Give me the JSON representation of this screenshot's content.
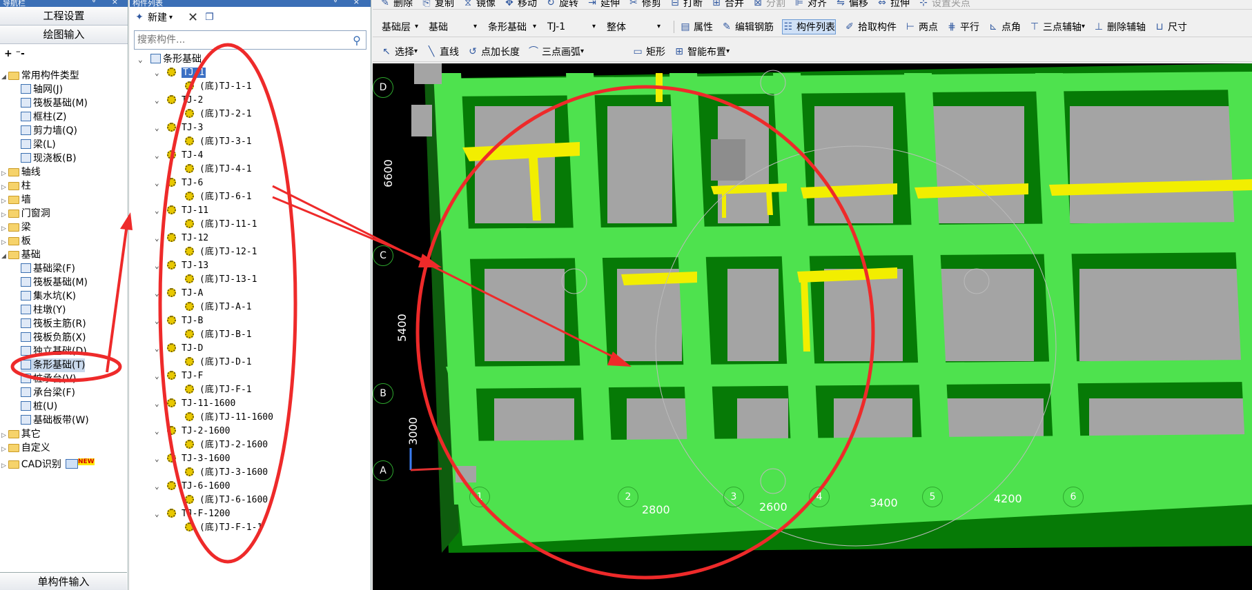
{
  "nav": {
    "title": "导航栏",
    "btn_project": "工程设置",
    "btn_draw": "绘图输入",
    "tree_tools": "+ ⁻-",
    "items": [
      {
        "label": "常用构件类型"
      },
      {
        "label": "轴网(J)"
      },
      {
        "label": "筏板基础(M)"
      },
      {
        "label": "框柱(Z)"
      },
      {
        "label": "剪力墙(Q)"
      },
      {
        "label": "梁(L)"
      },
      {
        "label": "现浇板(B)"
      },
      {
        "label": "轴线"
      },
      {
        "label": "柱"
      },
      {
        "label": "墙"
      },
      {
        "label": "门窗洞"
      },
      {
        "label": "梁"
      },
      {
        "label": "板"
      },
      {
        "label": "基础"
      },
      {
        "label": "基础梁(F)"
      },
      {
        "label": "筏板基础(M)"
      },
      {
        "label": "集水坑(K)"
      },
      {
        "label": "柱墩(Y)"
      },
      {
        "label": "筏板主筋(R)"
      },
      {
        "label": "筏板负筋(X)"
      },
      {
        "label": "独立基础(D)"
      },
      {
        "label": "条形基础(T)"
      },
      {
        "label": "桩承台(V)"
      },
      {
        "label": "承台梁(F)"
      },
      {
        "label": "桩(U)"
      },
      {
        "label": "基础板带(W)"
      },
      {
        "label": "其它"
      },
      {
        "label": "自定义"
      },
      {
        "label": "CAD识别"
      }
    ],
    "new_badge": "NEW",
    "bottom": "单构件输入"
  },
  "comp": {
    "title": "构件列表",
    "new_label": "新建",
    "search_placeholder": "搜索构件...",
    "root": "条形基础",
    "items": [
      {
        "name": "TJ-1",
        "child": "(底)TJ-1-1"
      },
      {
        "name": "TJ-2",
        "child": "(底)TJ-2-1"
      },
      {
        "name": "TJ-3",
        "child": "(底)TJ-3-1"
      },
      {
        "name": "TJ-4",
        "child": "(底)TJ-4-1"
      },
      {
        "name": "TJ-6",
        "child": "(底)TJ-6-1"
      },
      {
        "name": "TJ-11",
        "child": "(底)TJ-11-1"
      },
      {
        "name": "TJ-12",
        "child": "(底)TJ-12-1"
      },
      {
        "name": "TJ-13",
        "child": "(底)TJ-13-1"
      },
      {
        "name": "TJ-A",
        "child": "(底)TJ-A-1"
      },
      {
        "name": "TJ-B",
        "child": "(底)TJ-B-1"
      },
      {
        "name": "TJ-D",
        "child": "(底)TJ-D-1"
      },
      {
        "name": "TJ-F",
        "child": "(底)TJ-F-1"
      },
      {
        "name": "TJ-11-1600",
        "child": "(底)TJ-11-1600"
      },
      {
        "name": "TJ-2-1600",
        "child": "(底)TJ-2-1600"
      },
      {
        "name": "TJ-3-1600",
        "child": "(底)TJ-3-1600"
      },
      {
        "name": "TJ-6-1600",
        "child": "(底)TJ-6-1600"
      },
      {
        "name": "TJ-F-1200",
        "child": "(底)TJ-F-1-1"
      }
    ]
  },
  "toolbar1": [
    "删除",
    "复制",
    "镜像",
    "移动",
    "旋转",
    "延伸",
    "修剪",
    "打断",
    "合并",
    "分割",
    "对齐",
    "偏移",
    "拉伸",
    "设置夹点"
  ],
  "toolbar2": {
    "floor": "基础层",
    "category": "基础",
    "type": "条形基础",
    "component": "TJ-1",
    "scope": "整体",
    "buttons": [
      "属性",
      "编辑钢筋",
      "构件列表",
      "拾取构件",
      "两点",
      "平行",
      "点角",
      "三点辅轴",
      "删除辅轴",
      "尺寸"
    ]
  },
  "toolbar3": [
    "选择",
    "直线",
    "点加长度",
    "三点画弧",
    "矩形",
    "智能布置"
  ],
  "viewport": {
    "row_axes": [
      "D",
      "C",
      "B",
      "A"
    ],
    "col_axes": [
      "1",
      "2",
      "3",
      "4",
      "5",
      "6"
    ],
    "dims_vertical": [
      "6600",
      "5400",
      "3000"
    ],
    "dims_horizontal": [
      "2800",
      "2600",
      "3400",
      "4200"
    ],
    "colors": {
      "beam": "#4ee24e",
      "dark": "#067a06",
      "slab": "#a4a4a4",
      "yellow": "#f2ee00",
      "bg": "#000000",
      "annot": "#ee2a2a"
    }
  }
}
